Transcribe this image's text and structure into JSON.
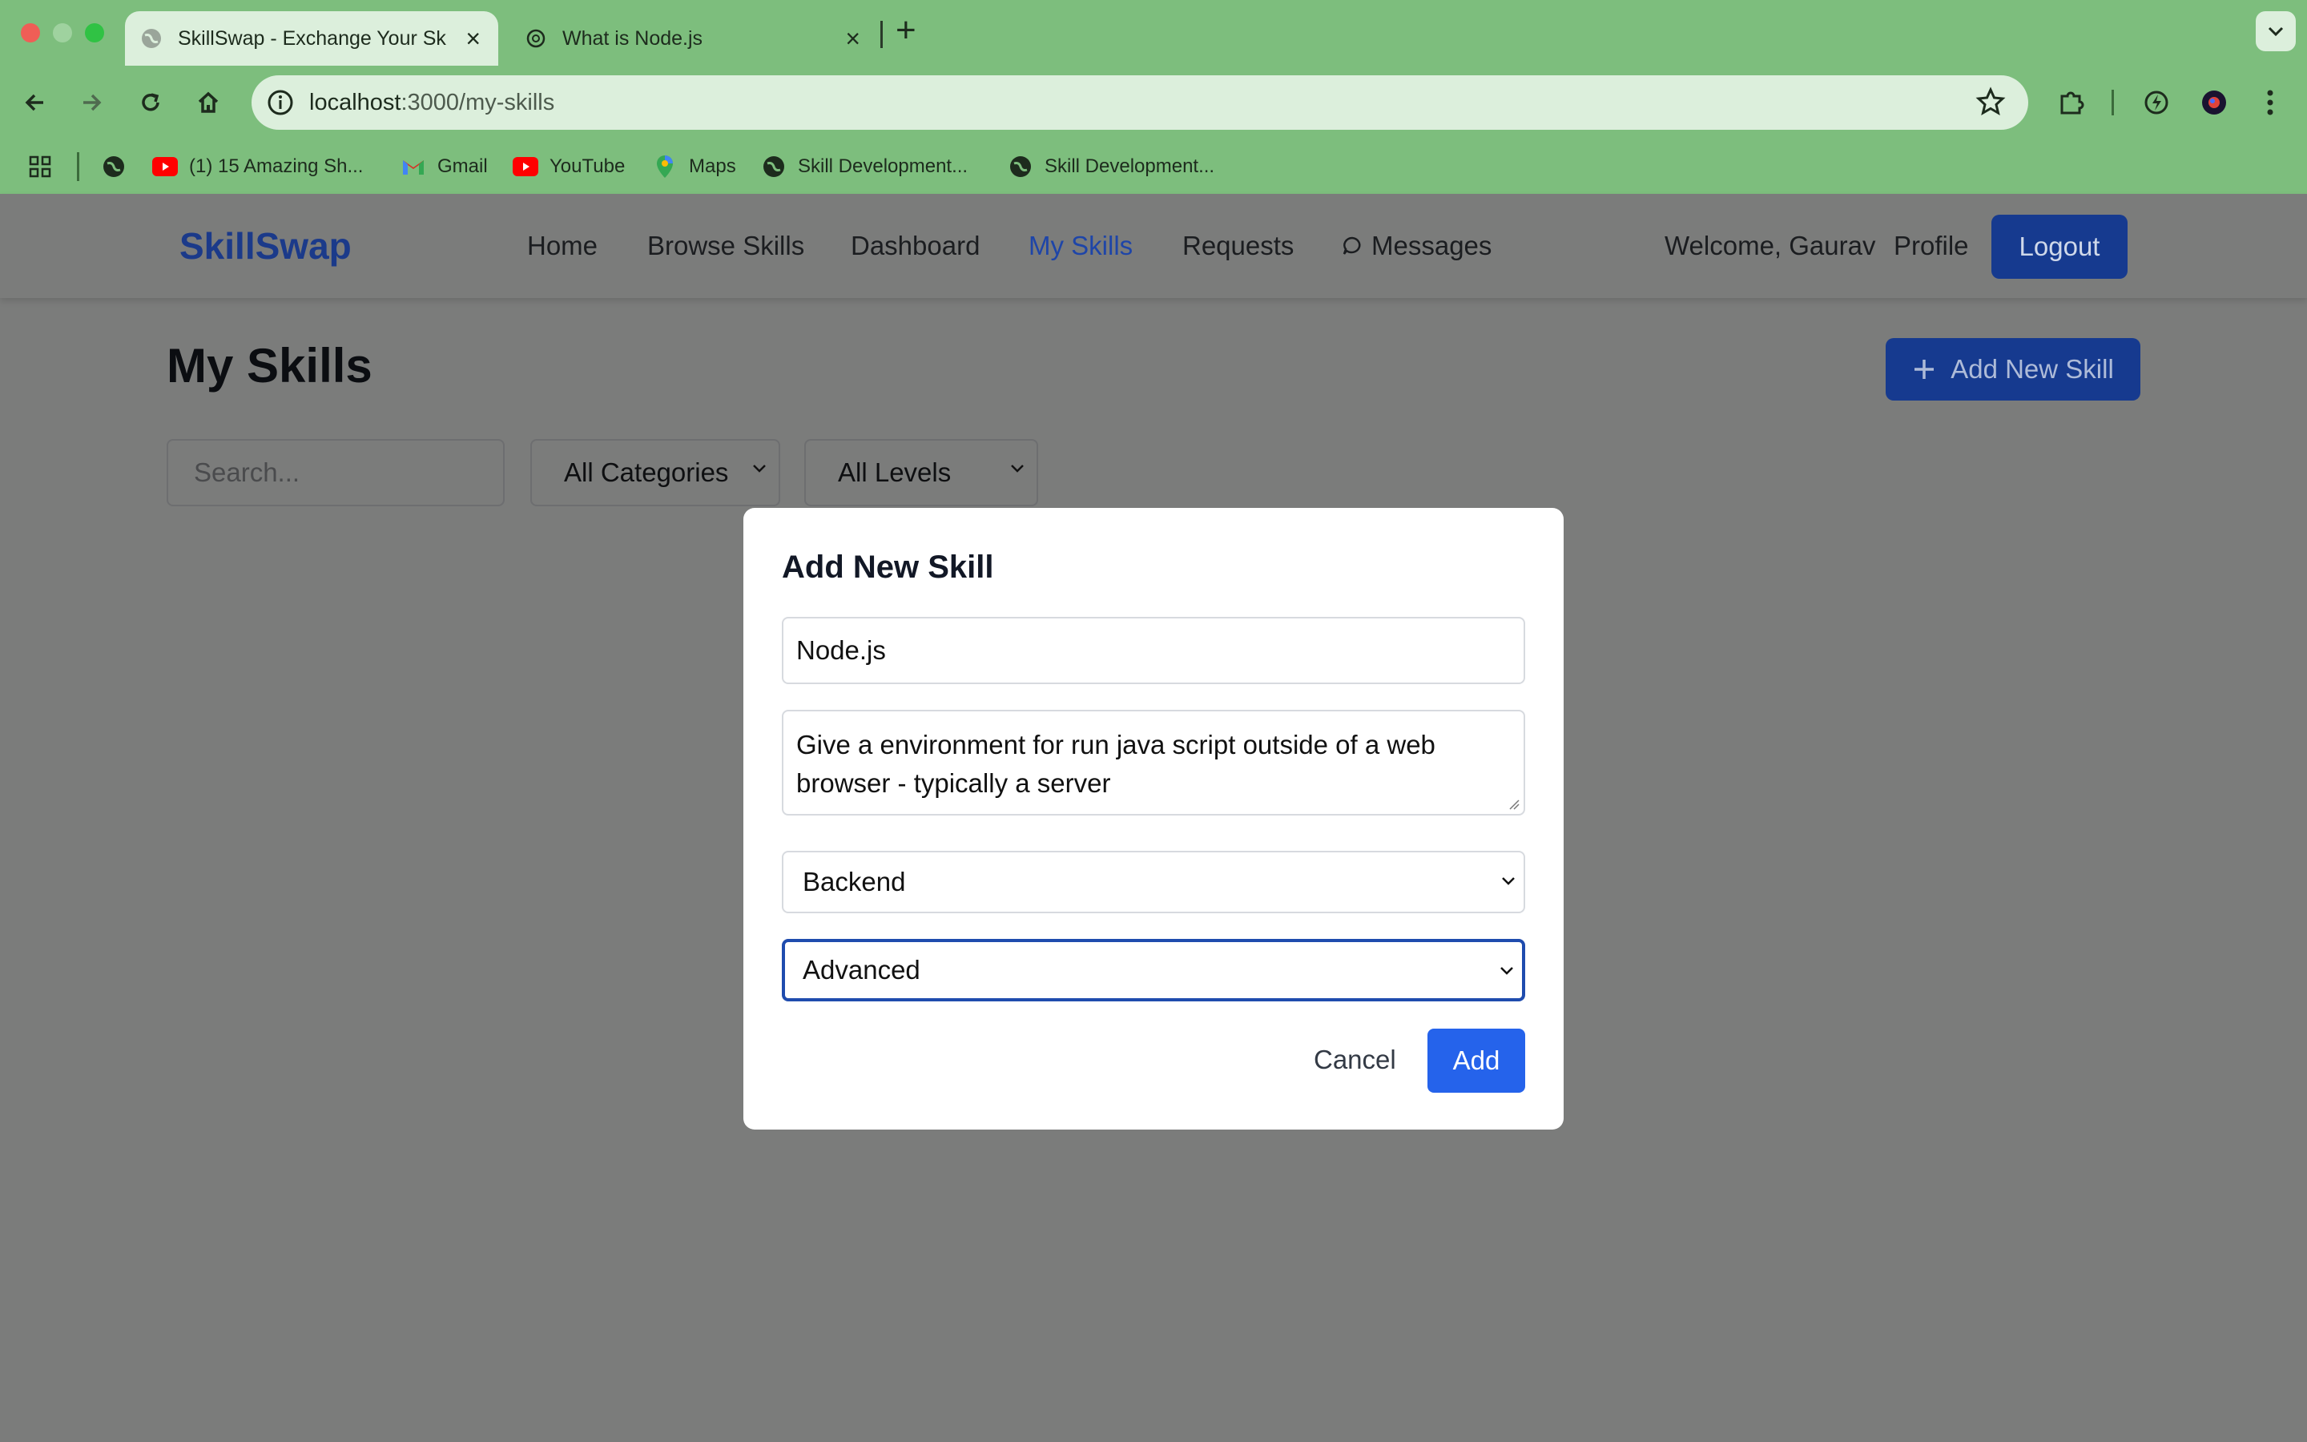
{
  "browser": {
    "tabs": [
      {
        "title": "SkillSwap - Exchange Your Sk",
        "active": true
      },
      {
        "title": "What is Node.js",
        "active": false
      }
    ],
    "url_host": "localhost",
    "url_path": ":3000/my-skills",
    "bookmarks": [
      {
        "label": "(1) 15 Amazing Sh...",
        "icon": "youtube-icon"
      },
      {
        "label": "Gmail",
        "icon": "gmail-icon"
      },
      {
        "label": "YouTube",
        "icon": "youtube-icon"
      },
      {
        "label": "Maps",
        "icon": "maps-icon"
      },
      {
        "label": "Skill Development...",
        "icon": "globe-icon"
      },
      {
        "label": "Skill Development...",
        "icon": "globe-icon"
      }
    ],
    "colors": {
      "chrome": "#7dbe7d",
      "chrome_light": "#dcefdc"
    }
  },
  "app": {
    "brand": "SkillSwap",
    "nav": {
      "home": "Home",
      "browse": "Browse Skills",
      "dashboard": "Dashboard",
      "my_skills": "My Skills",
      "requests": "Requests",
      "messages": "Messages"
    },
    "welcome": "Welcome, Gaurav",
    "profile": "Profile",
    "logout": "Logout",
    "page_title": "My Skills",
    "add_new_skill": "Add New Skill",
    "search_placeholder": "Search...",
    "category_filter": "All Categories",
    "level_filter": "All Levels",
    "colors": {
      "brand": "#1b3a8a",
      "primary": "#2563eb",
      "overlay": "#7b7c7b"
    }
  },
  "modal": {
    "title": "Add New Skill",
    "name_value": "Node.js",
    "description_value": "Give a environment for run java script outside of a web browser - typically a server",
    "category_value": "Backend",
    "level_value": "Advanced",
    "cancel": "Cancel",
    "add": "Add"
  }
}
